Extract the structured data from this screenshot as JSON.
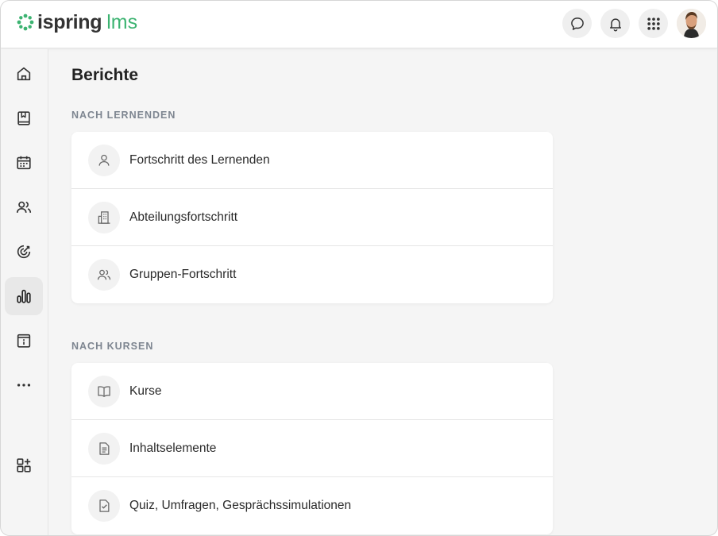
{
  "brand": {
    "name": "ispring",
    "product": "lms",
    "accent": "#3cb371"
  },
  "header": {
    "icons": [
      "chat-icon",
      "bell-icon",
      "apps-grid-icon"
    ],
    "avatar": "avatar"
  },
  "sidebar": {
    "items": [
      {
        "icon": "home-icon",
        "active": false
      },
      {
        "icon": "book-icon",
        "active": false
      },
      {
        "icon": "calendar-icon",
        "active": false
      },
      {
        "icon": "users-icon",
        "active": false
      },
      {
        "icon": "target-icon",
        "active": false
      },
      {
        "icon": "bar-chart-icon",
        "active": true
      },
      {
        "icon": "info-card-icon",
        "active": false
      },
      {
        "icon": "more-icon",
        "active": false
      },
      {
        "icon": "add-widget-icon",
        "active": false
      }
    ]
  },
  "page": {
    "title": "Berichte",
    "sections": [
      {
        "label": "NACH LERNENDEN",
        "items": [
          {
            "label": "Fortschritt des Lernenden",
            "icon": "user-icon"
          },
          {
            "label": "Abteilungsfortschritt",
            "icon": "building-icon"
          },
          {
            "label": "Gruppen-Fortschritt",
            "icon": "group-icon"
          }
        ]
      },
      {
        "label": "NACH KURSEN",
        "items": [
          {
            "label": "Kurse",
            "icon": "open-book-icon"
          },
          {
            "label": "Inhaltselemente",
            "icon": "document-icon"
          },
          {
            "label": "Quiz, Umfragen, Gesprächssimulationen",
            "icon": "checklist-icon"
          }
        ]
      }
    ]
  }
}
